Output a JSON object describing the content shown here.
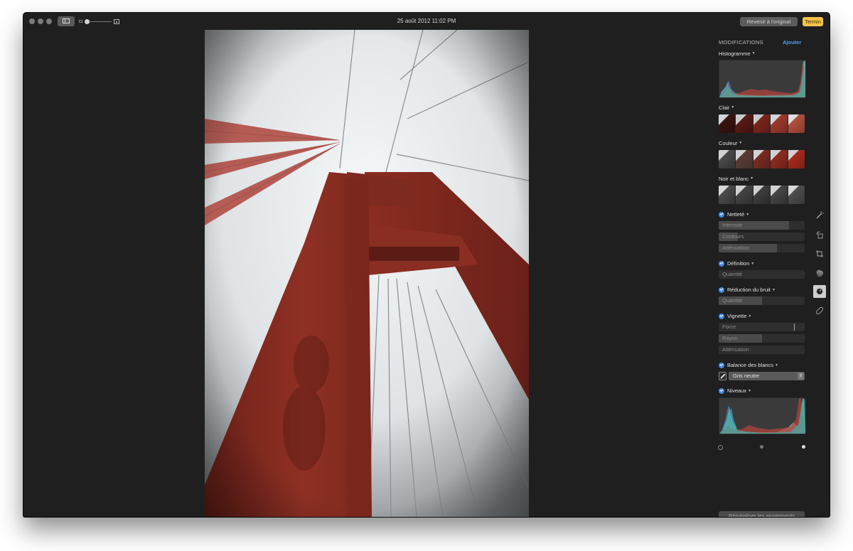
{
  "window": {
    "title": "25 août 2012 11:02 PM",
    "buttons": {
      "revert": "Revenir à l'original",
      "done": "Termin"
    },
    "traffic_lights": [
      "close",
      "minimize",
      "zoom"
    ],
    "toolbar_icons": [
      "sidebar-toggle-icon",
      "thumbnail-small-icon",
      "zoom-slider",
      "thumbnail-large-icon"
    ]
  },
  "photo": {
    "subject": "Golden Gate Bridge tower viewed from below",
    "colors": {
      "sky": "#e9ecee",
      "tower": "#8e2e22",
      "tower_dark": "#5e1c16",
      "cable": "#b8574f"
    }
  },
  "panel": {
    "header": "MODIFICATIONS",
    "add_label": "Ajouter",
    "sections": {
      "histogram": {
        "label": "Histogramme"
      },
      "light": {
        "label": "Clair",
        "variants": 5
      },
      "color": {
        "label": "Couleur",
        "variants": 5
      },
      "bw": {
        "label": "Noir et blanc",
        "variants": 5
      },
      "sharpen": {
        "label": "Netteté",
        "enabled": true,
        "sliders": [
          {
            "label": "Intensité",
            "value": 0.82
          },
          {
            "label": "Contours",
            "value": 0.22
          },
          {
            "label": "Atténuation",
            "value": 0.68
          }
        ]
      },
      "definition": {
        "label": "Définition",
        "enabled": true,
        "sliders": [
          {
            "label": "Quantité",
            "value": 0.0
          }
        ]
      },
      "noise": {
        "label": "Réduction du bruit",
        "enabled": true,
        "sliders": [
          {
            "label": "Quantité",
            "value": 0.5
          }
        ]
      },
      "vignette": {
        "label": "Vignette",
        "enabled": true,
        "sliders": [
          {
            "label": "Force",
            "value": 0.88
          },
          {
            "label": "Rayon",
            "value": 0.5
          },
          {
            "label": "Atténuation",
            "value": 0.0
          }
        ]
      },
      "white_balance": {
        "label": "Balance des blancs",
        "enabled": true,
        "selected": "Gris neutre"
      },
      "levels": {
        "label": "Niveaux",
        "enabled": true
      }
    },
    "reset_label": "Réinitialiser les ajustements"
  },
  "tools": [
    "enhance",
    "rotate",
    "crop",
    "filters",
    "adjust",
    "retouch"
  ],
  "active_tool": "adjust",
  "accent": "#4aa1f2",
  "done_color": "#f5c34a"
}
